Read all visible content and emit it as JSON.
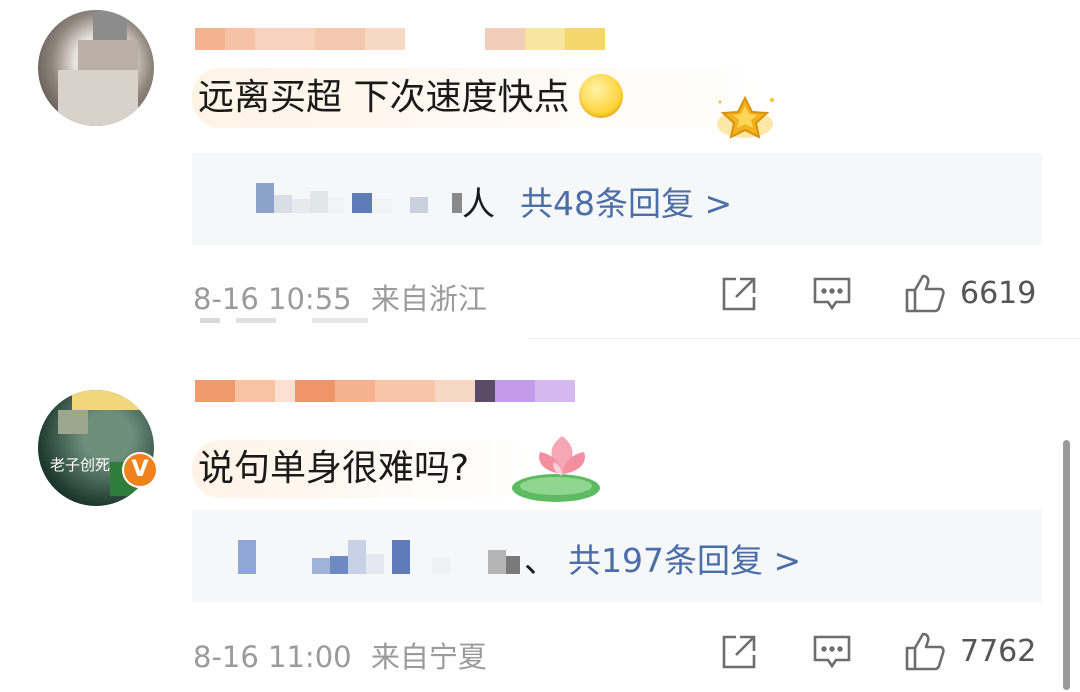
{
  "comments": [
    {
      "text": "远离买超 下次速度快点",
      "emoji": "smile-emoji",
      "badge": "gold-star-badge",
      "reply_suffix": "人",
      "reply_link": "共48条回复 >",
      "date": "8-16 10:55",
      "location": "来自浙江",
      "likes": "6619"
    },
    {
      "text": "说句单身很难吗?",
      "emoji": "lotus-sticker",
      "avatar_text": "老子创死",
      "avatar_badge": "V",
      "reply_suffix": "、",
      "reply_link": "共197条回复 >",
      "date": "8-16 11:00",
      "location": "来自宁夏",
      "likes": "7762"
    }
  ],
  "colors": {
    "link": "#4a6ea8",
    "meta": "#9b9b9b",
    "reply_bg": "#f6f7f9",
    "verified_orange": "#f0821e"
  },
  "icons": [
    "share-icon",
    "comment-icon",
    "like-icon"
  ]
}
